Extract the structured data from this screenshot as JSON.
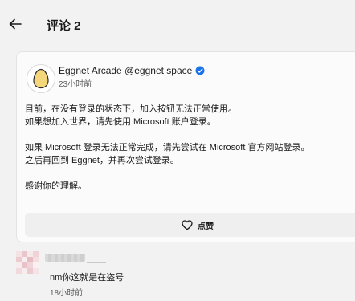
{
  "header": {
    "title": "评论 2"
  },
  "post": {
    "author": "Eggnet Arcade @eggnet space",
    "time": "23小时前",
    "body": [
      "目前，在没有登录的状态下，加入按钮无法正常使用。",
      "如果想加入世界，请先使用 Microsoft 账户登录。",
      "",
      "如果 Microsoft 登录无法正常完成，请先尝试在 Microsoft 官方网站登录。",
      "之后再回到 Eggnet，并再次尝试登录。",
      "",
      "感谢你的理解。"
    ],
    "like_label": "点赞"
  },
  "comment": {
    "text": "nm你这就是在盗号",
    "time": "18小时前"
  },
  "colors": {
    "verified": "#1a73e8",
    "egg": "#f3d77a",
    "background": "#f2f2f2"
  }
}
